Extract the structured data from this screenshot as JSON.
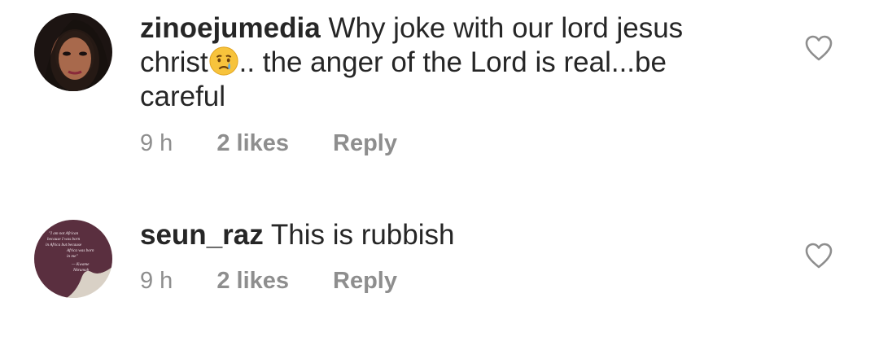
{
  "comments": [
    {
      "username": "zinoejumedia",
      "text_before": "Why joke with our lord jesus christ",
      "emoji": "crying-face-emoji",
      "text_after": ".. the anger of the Lord is real...be careful",
      "time": "9 h",
      "likes": "2 likes",
      "reply": "Reply",
      "avatar": "profile-photo-avatar",
      "like_icon": "heart-icon"
    },
    {
      "username": "seun_raz",
      "text_before": "This is rubbish",
      "time": "9 h",
      "likes": "2 likes",
      "reply": "Reply",
      "avatar": "quote-image-avatar",
      "avatar_quote": [
        "\"I am not African",
        "because I was born",
        "in Africa but because",
        "Africa was born",
        "in me\"",
        "— Kwame",
        "Nkrumah"
      ],
      "like_icon": "heart-icon"
    }
  ],
  "colors": {
    "text": "#262626",
    "meta": "#8e8e8e",
    "heart_stroke": "#8e8e8e",
    "quote_bg": "#5a2f3f"
  }
}
